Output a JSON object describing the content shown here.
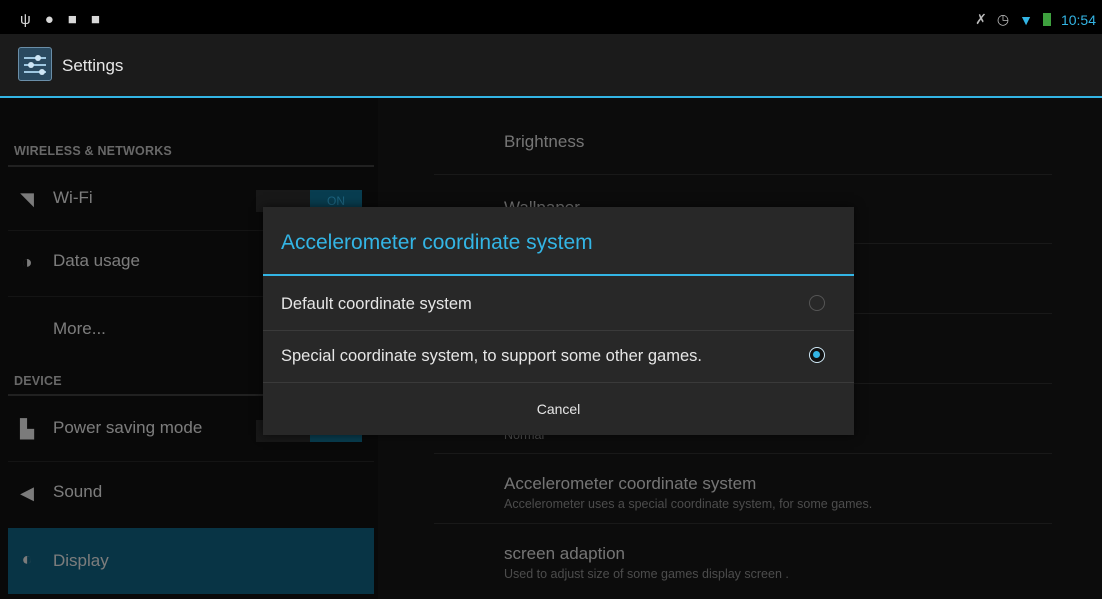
{
  "status_bar": {
    "left_icons": [
      "usb-icon",
      "android-debug-icon",
      "download-icon",
      "download-icon"
    ],
    "right_icons": [
      "mute-icon",
      "alarm-icon",
      "wifi-icon",
      "battery-icon"
    ],
    "time": "10:54"
  },
  "action_bar": {
    "title": "Settings"
  },
  "sidebar": {
    "sections": [
      {
        "header": "WIRELESS & NETWORKS"
      },
      {
        "header": "DEVICE"
      }
    ],
    "items": [
      {
        "label": "Wi-Fi",
        "icon": "wifi-icon",
        "toggle": "ON"
      },
      {
        "label": "Data usage",
        "icon": "data-usage-icon"
      },
      {
        "label": "More..."
      },
      {
        "label": "Power saving mode",
        "icon": "power-saving-icon",
        "toggle": "ON"
      },
      {
        "label": "Sound",
        "icon": "speaker-icon"
      },
      {
        "label": "Display",
        "icon": "display-icon",
        "selected": true
      }
    ]
  },
  "display_prefs": [
    {
      "title": "Brightness"
    },
    {
      "title": "Wallpaper"
    },
    {
      "title": "",
      "summary": "Normal"
    },
    {
      "title": "Accelerometer coordinate system",
      "summary": "Accelerometer uses a special coordinate system, for some games."
    },
    {
      "title": "screen adaption",
      "summary": "Used to adjust size of some games display screen ."
    }
  ],
  "dialog": {
    "title": "Accelerometer coordinate system",
    "options": [
      {
        "label": "Default coordinate system",
        "selected": false
      },
      {
        "label": "Special coordinate system, to support some other games.",
        "selected": true
      }
    ],
    "cancel_label": "Cancel"
  },
  "colors": {
    "accent": "#33b5e5",
    "selected_item": "#0f5f7e"
  }
}
